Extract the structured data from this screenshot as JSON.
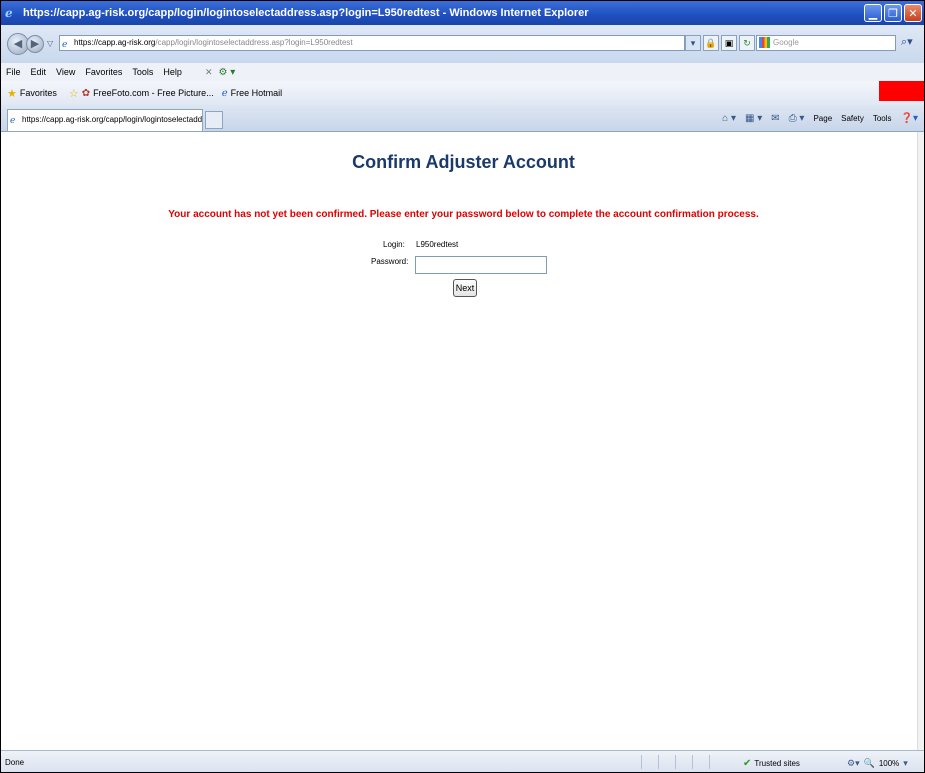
{
  "window": {
    "title": "https://capp.ag-risk.org/capp/login/logintoselectaddress.asp?login=L950redtest - Windows Internet Explorer"
  },
  "address_bar": {
    "scheme": "https://",
    "host": "capp.ag-risk.org",
    "path": "/capp/login/logintoselectaddress.asp?login=L950redtest"
  },
  "search": {
    "placeholder": "Google"
  },
  "menu": {
    "items": [
      "File",
      "Edit",
      "View",
      "Favorites",
      "Tools",
      "Help"
    ]
  },
  "favorites": {
    "label": "Favorites",
    "links": [
      "FreeFoto.com - Free Picture...",
      "Free Hotmail"
    ]
  },
  "tab": {
    "title": "https://capp.ag-risk.org/capp/login/logintoselectaddr..."
  },
  "command_bar": {
    "page": "Page",
    "safety": "Safety",
    "tools": "Tools"
  },
  "content": {
    "heading": "Confirm Adjuster Account",
    "notice": "Your account has not yet been confirmed. Please enter your password below to complete the account confirmation process.",
    "login_label": "Login:",
    "login_value": "L950redtest",
    "password_label": "Password:",
    "password_value": "",
    "next_button": "Next"
  },
  "status_bar": {
    "status": "Done",
    "zone": "Trusted sites",
    "zoom": "100%"
  },
  "colors": {
    "heading": "#1b3a6b",
    "notice": "#e00000",
    "redaction": "#ff0000"
  }
}
